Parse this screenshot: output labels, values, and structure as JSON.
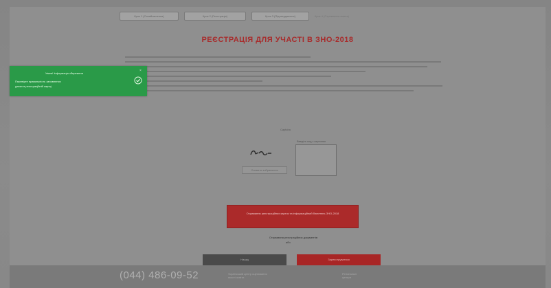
{
  "nav": {
    "pills": [
      "Крок 1 (Ознайомлення)",
      "Крок 2 (Реєстрація)",
      "Крок 3 (Підтвердження)"
    ],
    "crumb": "Крок 4 (Отримання пакета)"
  },
  "title": "РЕЄСТРАЦІЯ ДЛЯ УЧАСТІ В ЗНО-2018",
  "toast": {
    "title": "Увага! Інформація збережена",
    "line1": "Перевірте правильність заповнених",
    "line2": "даних в реєстраційній картці",
    "close": "×"
  },
  "captcha": {
    "label": "Captcha",
    "image_text": "ƃ‹ɑ‹",
    "refresh": "Оновити зображення",
    "input_label": "Введіть код з картинки"
  },
  "consent": {
    "button_label": "Отримання реєстраційних карток та інформаційний бюлетень ЗНО-2018",
    "note": "Отримання реєстраційних документів",
    "note2": "або"
  },
  "buttons": {
    "back": "Назад",
    "next": "Зареєструватися"
  },
  "footer": {
    "phone": "(044) 486-09-52",
    "block1_l1": "Український центр оцінювання",
    "block1_l2": "якості освіти",
    "block2_l1": "Регіональні",
    "block2_l2": "центри"
  },
  "colors": {
    "accent_red": "#a82b2b",
    "toast_green": "#2a9a48",
    "back_dark": "#4a4a4a"
  }
}
